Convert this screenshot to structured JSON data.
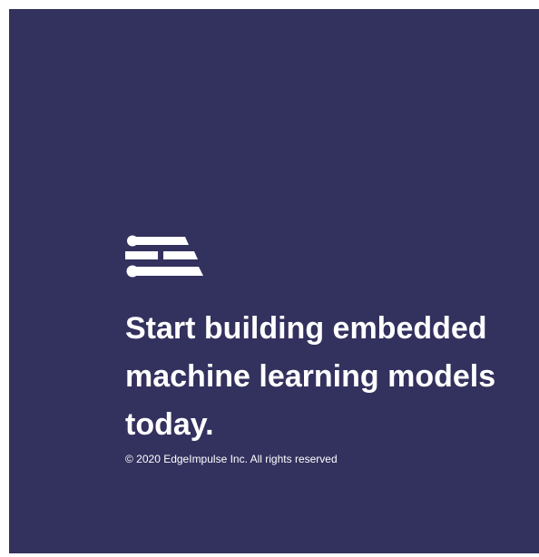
{
  "brand": {
    "logo_icon": "edge-impulse-logo-icon",
    "background_color": "#33315e",
    "text_color": "#ffffff"
  },
  "hero": {
    "headline": "Start building embedded machine learning models today."
  },
  "footer": {
    "copyright": "© 2020 EdgeImpulse Inc. All rights reserved"
  }
}
